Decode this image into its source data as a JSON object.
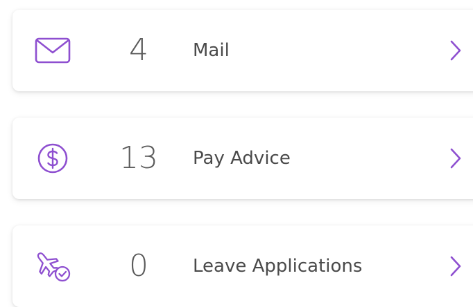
{
  "accent_color": "#8e4fd0",
  "items": [
    {
      "icon": "mail-icon",
      "count": "4",
      "label": "Mail"
    },
    {
      "icon": "dollar-icon",
      "count": "13",
      "label": "Pay Advice"
    },
    {
      "icon": "plane-check-icon",
      "count": "0",
      "label": "Leave Applications"
    }
  ],
  "chevron_icon": "chevron-right-icon"
}
